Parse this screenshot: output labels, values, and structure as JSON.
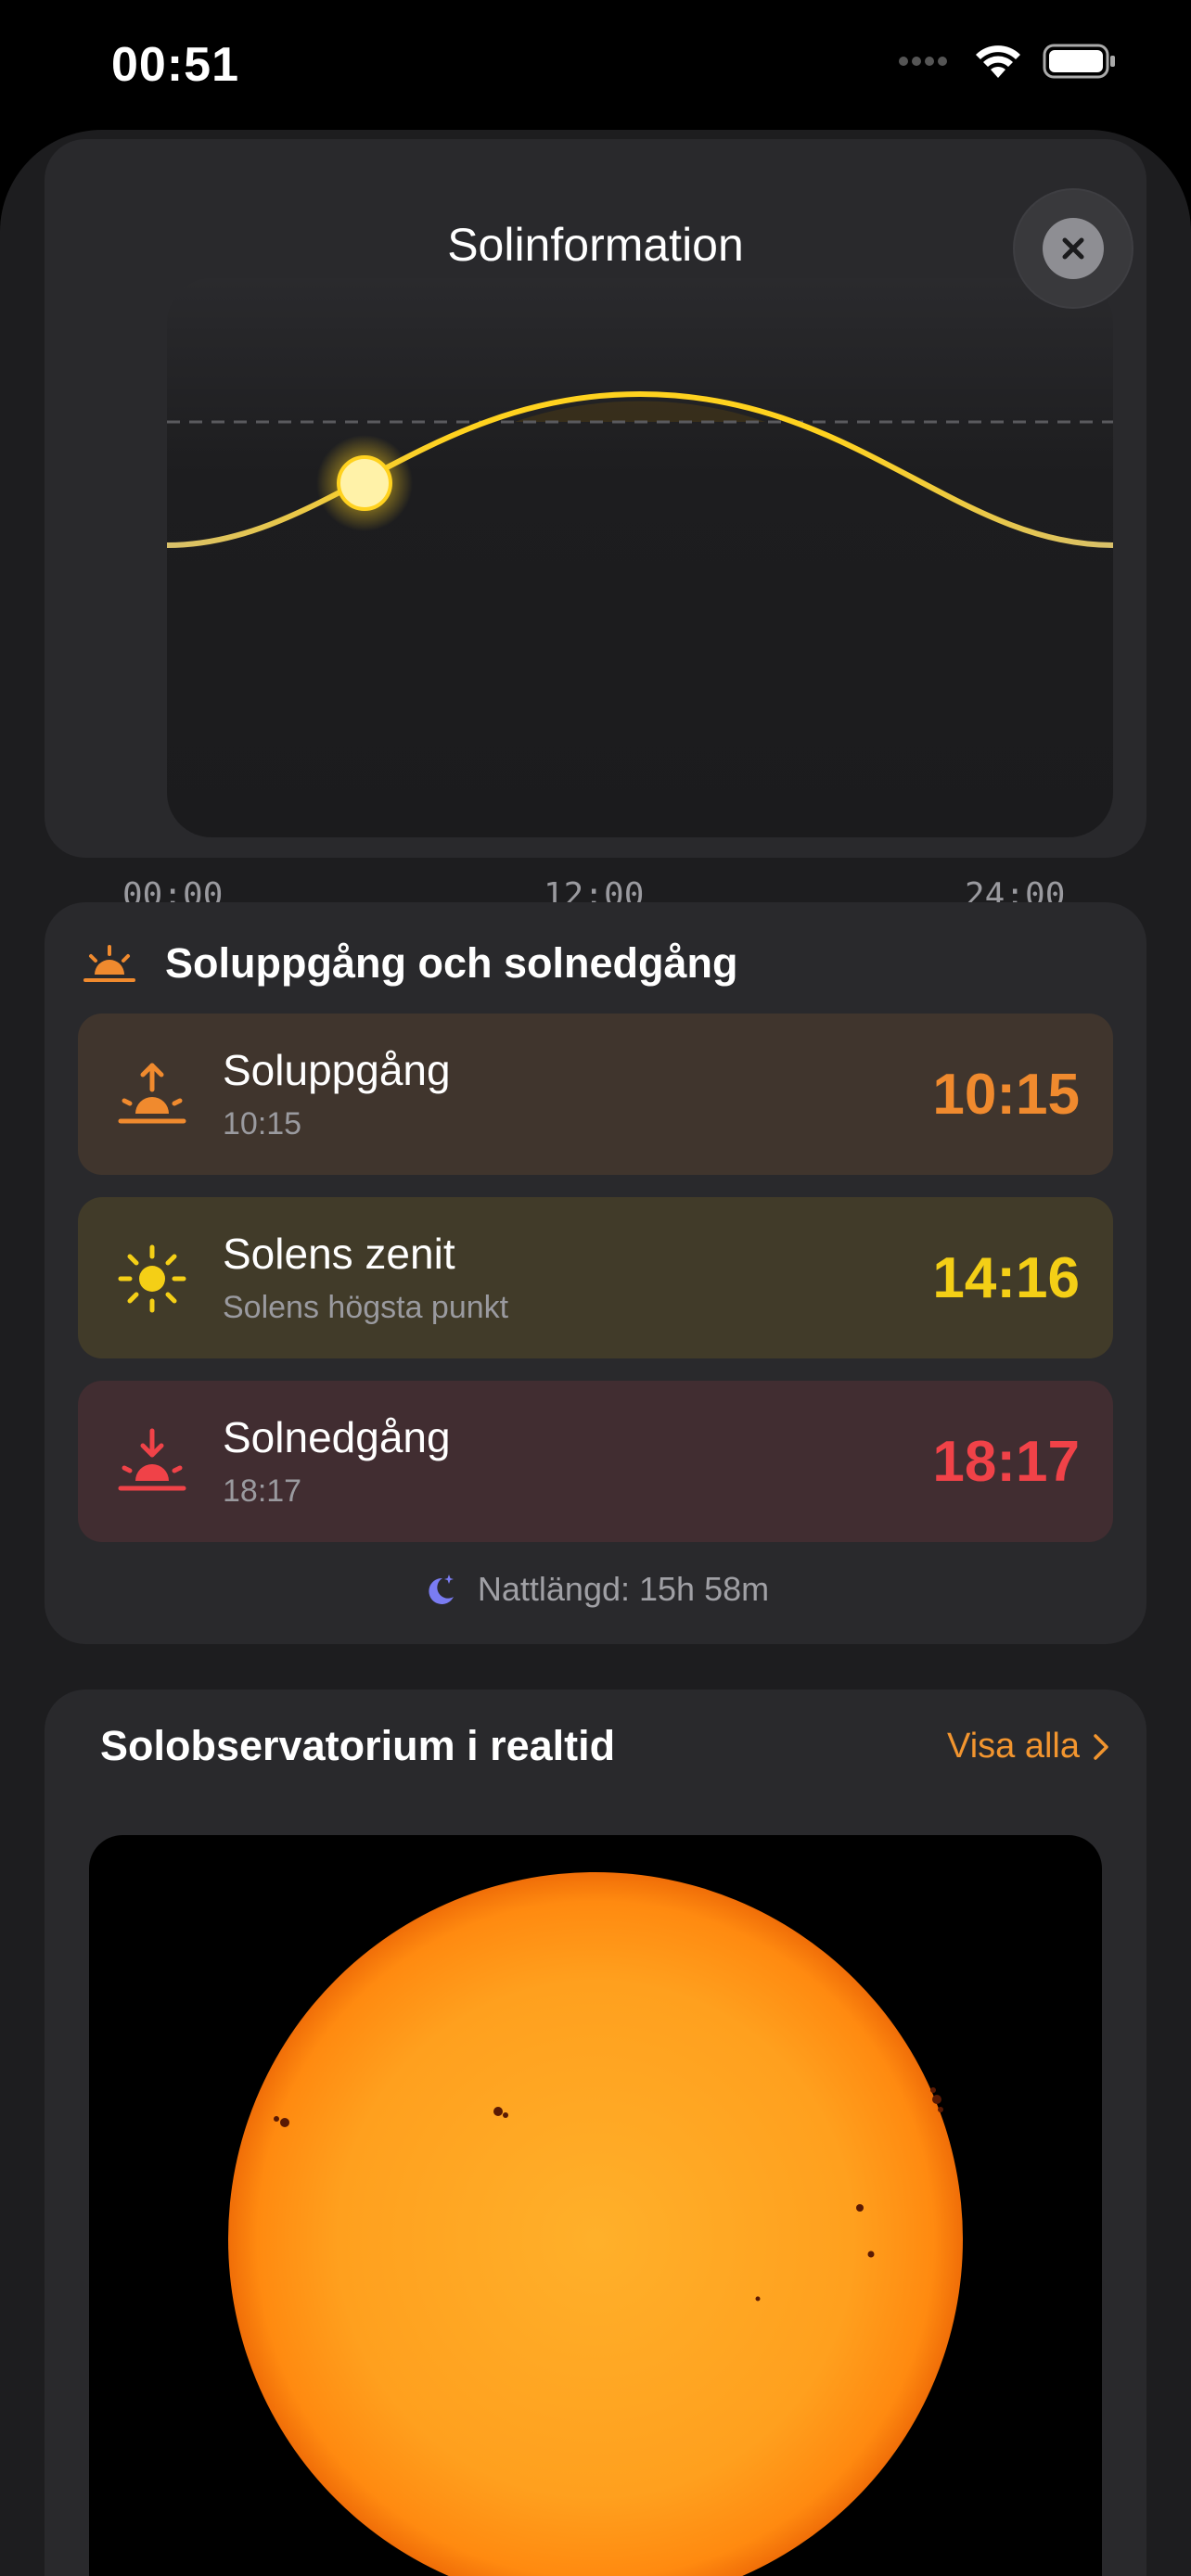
{
  "status_bar": {
    "time": "00:51"
  },
  "sheet": {
    "title": "Solinformation"
  },
  "chart_data": {
    "type": "line",
    "title": "",
    "x_labels": [
      "00:00",
      "12:00",
      "24:00"
    ],
    "current_time": "00:51",
    "curve_color": "#ffd21f",
    "marker_color": "#fff2a8"
  },
  "sun_section": {
    "title": "Soluppgång och solnedgång",
    "events": [
      {
        "name": "Soluppgång",
        "subtitle": "10:15",
        "time": "10:15",
        "color": "#f08a2e",
        "icon": "sunrise-icon"
      },
      {
        "name": "Solens zenit",
        "subtitle": "Solens högsta punkt",
        "time": "14:16",
        "color": "#f4cf16",
        "icon": "sun-icon"
      },
      {
        "name": "Solnedgång",
        "subtitle": "18:17",
        "time": "18:17",
        "color": "#f04248",
        "icon": "sunset-icon"
      }
    ],
    "night_length": "Nattlängd: 15h 58m"
  },
  "observatory": {
    "title": "Solobservatorium i realtid",
    "link_label": "Visa alla"
  }
}
